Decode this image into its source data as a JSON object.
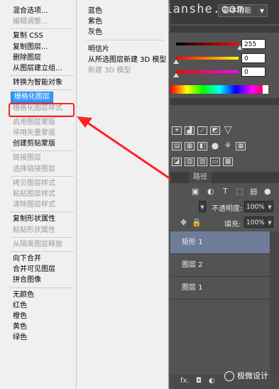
{
  "watermark": "www.haoyidianshe.com",
  "workspace": {
    "label": "基本功能"
  },
  "color_panel": {
    "r_value": "255",
    "g_value": "0",
    "b_value": "0"
  },
  "layers_panel": {
    "tab_paths": "路径",
    "opacity_label": "不透明度:",
    "opacity_value": "100%",
    "fill_label": "填充:",
    "fill_value": "100%",
    "layers": [
      {
        "name": "矩形 1",
        "selected": true
      },
      {
        "name": "图层 2",
        "selected": false
      },
      {
        "name": "图层 1",
        "selected": false
      }
    ],
    "badge_text": "极微设计"
  },
  "context_menu": {
    "left_groups": [
      [
        "混合选项...",
        "编辑调整..."
      ],
      [
        "复制 CSS",
        "复制图层...",
        "删除图层",
        "从图层建立组..."
      ],
      [
        "转换为智能对象"
      ],
      [
        "栅格化图层",
        "栅格化图层样式"
      ],
      [
        "启用图层蒙版",
        "停用矢量蒙版",
        "创建剪贴蒙版"
      ],
      [
        "链接图层",
        "选择链接图层"
      ],
      [
        "拷贝图层样式",
        "粘贴图层样式",
        "清除图层样式"
      ],
      [
        "复制形状属性",
        "粘贴形状属性"
      ],
      [
        "从隔离图层释放"
      ],
      [
        "向下合并",
        "合并可见图层",
        "拼合图像"
      ],
      [
        "无颜色",
        "红色",
        "橙色",
        "黄色",
        "绿色"
      ]
    ],
    "disabled": [
      "编辑调整...",
      "栅格化图层样式",
      "启用图层蒙版",
      "停用矢量蒙版",
      "链接图层",
      "选择链接图层",
      "拷贝图层样式",
      "粘贴图层样式",
      "清除图层样式",
      "粘贴形状属性",
      "从隔离图层释放",
      "新建 3D 模型"
    ],
    "highlighted": "栅格化图层",
    "right_groups": [
      [
        "蓝色",
        "紫色",
        "灰色"
      ],
      [
        "明信片",
        "从所选图层新建 3D 模型",
        "新建 3D 模型"
      ]
    ]
  },
  "colors": {
    "highlight": "#3399ff",
    "annotation": "#ff2222",
    "selected_layer": "#6e7c99"
  }
}
